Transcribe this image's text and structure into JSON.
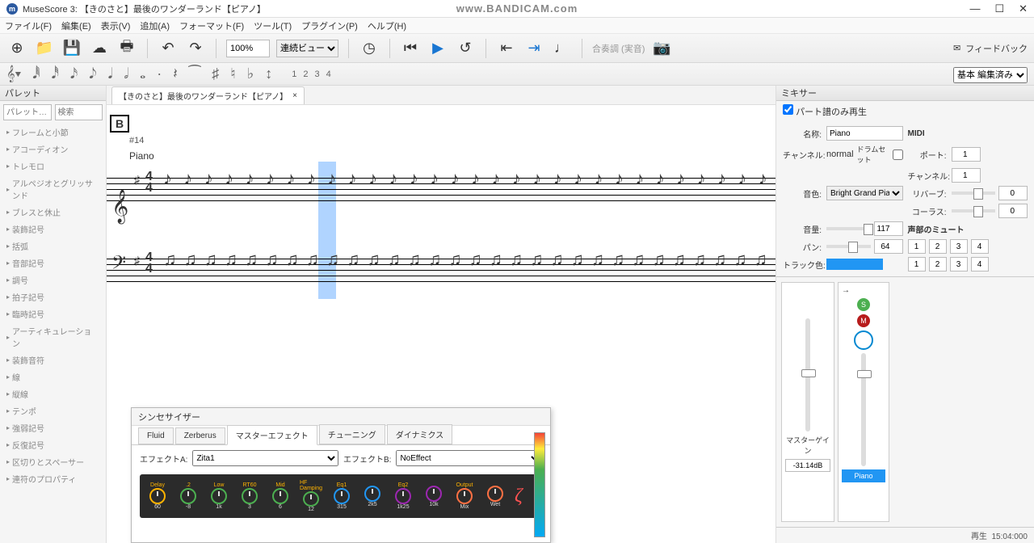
{
  "window": {
    "title": "MuseScore 3: 【きのさと】最後のワンダーランド【ピアノ】",
    "watermark": "www.BANDICAM.com",
    "controls": {
      "min": "—",
      "max": "☐",
      "close": "✕"
    }
  },
  "menu": [
    "ファイル(F)",
    "編集(E)",
    "表示(V)",
    "追加(A)",
    "フォーマット(F)",
    "ツール(T)",
    "プラグイン(P)",
    "ヘルプ(H)"
  ],
  "toolbar1": {
    "zoom": "100%",
    "view_mode": "連続ビュー",
    "synth_label": "合奏調 (実音)",
    "feedback": "フィードバック"
  },
  "toolbar2": {
    "voices": [
      "1",
      "2",
      "3",
      "4"
    ],
    "mode": "基本 編集済み"
  },
  "palette": {
    "title": "パレット",
    "filter_placeholder": "パレット…",
    "search_placeholder": "検索",
    "items": [
      "フレームと小節",
      "アコーディオン",
      "トレモロ",
      "アルペジオとグリッサンド",
      "ブレスと休止",
      "装飾記号",
      "括弧",
      "音部記号",
      "調号",
      "拍子記号",
      "臨時記号",
      "アーティキュレーション",
      "装飾音符",
      "線",
      "縦線",
      "テンポ",
      "強弱記号",
      "反復記号",
      "区切りとスペーサー",
      "連符のプロパティ"
    ]
  },
  "tab": {
    "label": "【きのさと】最後のワンダーランド【ピアノ】",
    "close": "×"
  },
  "score": {
    "rehearsal": "B",
    "measure_label": "#14",
    "part": "Piano",
    "treble_notes": [
      "♪",
      "♪",
      "♪",
      "♪",
      "♪",
      "♪",
      "♪",
      "♪",
      "♪",
      "♪",
      "♪",
      "♪",
      "♪",
      "♪",
      "♪",
      "♪",
      "♪",
      "♪",
      "♪",
      "♪",
      "♪",
      "♪",
      "♪",
      "♪",
      "♪",
      "♪",
      "♪",
      "♪",
      "♪",
      "♪"
    ],
    "bass_notes": [
      "♫",
      "♫",
      "♫",
      "♫",
      "♫",
      "♫",
      "♫",
      "♫",
      "♫",
      "♫",
      "♫",
      "♫",
      "♫",
      "♫",
      "♫",
      "♫",
      "♫",
      "♫",
      "♫",
      "♫",
      "♫",
      "♫",
      "♫",
      "♫",
      "♫",
      "♫",
      "♫",
      "♫",
      "♫",
      "♫"
    ]
  },
  "synth": {
    "title": "シンセサイザー",
    "tabs": [
      "Fluid",
      "Zerberus",
      "マスターエフェクト",
      "チューニング",
      "ダイナミクス"
    ],
    "active_tab": 2,
    "fxA_label": "エフェクトA:",
    "fxA_value": "Zita1",
    "fxB_label": "エフェクトB:",
    "fxB_value": "NoEffect",
    "knobs": [
      {
        "label": "Delay",
        "val": "60"
      },
      {
        "label": ".2",
        "val": "-8"
      },
      {
        "label": "Low",
        "val": "1k"
      },
      {
        "label": "RT60",
        "val": "3"
      },
      {
        "label": "Mid",
        "val": "6"
      },
      {
        "label": "HF Damping",
        "val": "12"
      },
      {
        "label": "Eq1",
        "val": "315"
      },
      {
        "label": "",
        "val": "2k5"
      },
      {
        "label": "Eq2",
        "val": "1k25"
      },
      {
        "label": "",
        "val": "10k"
      },
      {
        "label": "Output",
        "val": "Mix"
      },
      {
        "label": "",
        "val": "Wet"
      }
    ]
  },
  "mixer": {
    "title": "ミキサー",
    "part_only": "パート譜のみ再生",
    "name_label": "名称:",
    "name_value": "Piano",
    "midi_label": "MIDI",
    "channel_label": "チャンネル:",
    "channel_value": "normal",
    "drum_label": "ドラムセット",
    "port_label": "ポート:",
    "midi_ch_label": "チャンネル:",
    "port_value": "1",
    "midi_ch_value": "1",
    "sound_label": "音色:",
    "sound_value": "Bright Grand Piano",
    "reverb_label": "リバーブ:",
    "reverb_value": "0",
    "chorus_label": "コーラス:",
    "chorus_value": "0",
    "volume_label": "音量:",
    "volume_value": "117",
    "mute_section": "声部のミュート",
    "pan_label": "パン:",
    "pan_value": "64",
    "mute_btns_1": [
      "1",
      "2",
      "3",
      "4"
    ],
    "mute_btns_2": [
      "1",
      "2",
      "3",
      "4"
    ],
    "trackcolor_label": "トラック色:",
    "master_gain_label": "マスターゲイン",
    "master_gain_value": "-31.14dB",
    "strip_name": "Piano",
    "status_label": "再生",
    "status_time": "15:04:000"
  }
}
